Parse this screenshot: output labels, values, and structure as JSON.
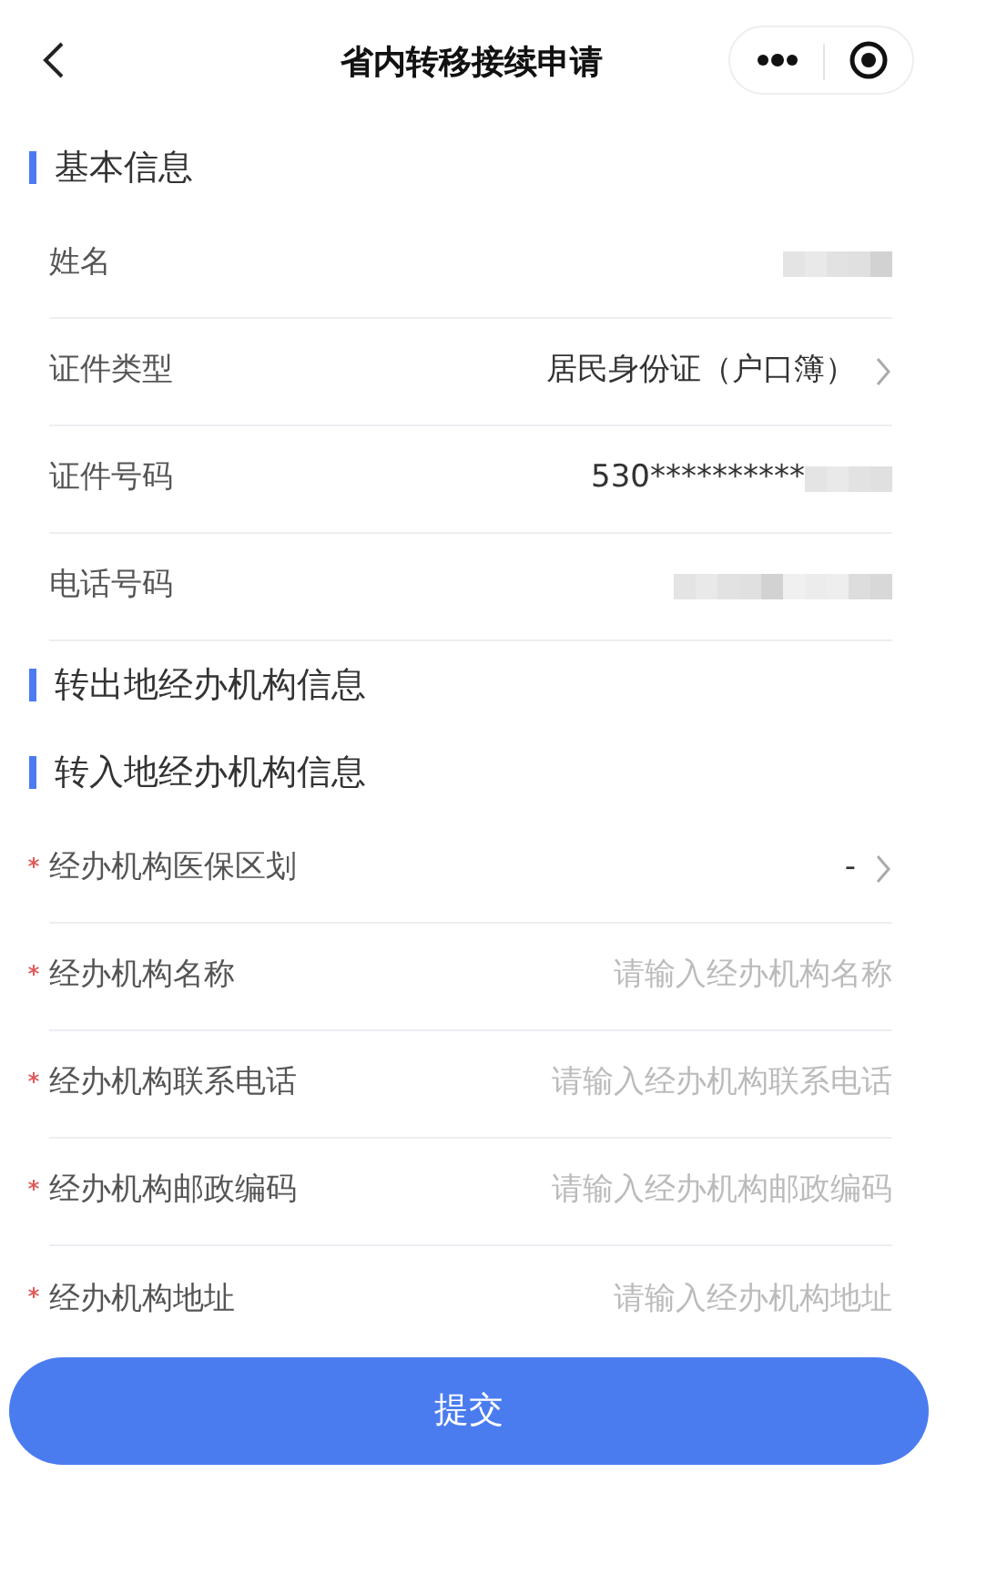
{
  "header": {
    "title": "省内转移接续申请"
  },
  "sections": [
    {
      "title": "基本信息",
      "rows": [
        {
          "kind": "redacted",
          "label": "姓名",
          "required": false
        },
        {
          "kind": "select",
          "label": "证件类型",
          "value": "居民身份证（户口簿）",
          "required": false
        },
        {
          "kind": "partial",
          "label": "证件号码",
          "value": "530**********",
          "required": false
        },
        {
          "kind": "redacted",
          "label": "电话号码",
          "required": false
        }
      ]
    },
    {
      "title": "转出地经办机构信息"
    },
    {
      "title": "转入地经办机构信息",
      "rows": [
        {
          "kind": "select",
          "label": "经办机构医保区划",
          "value": "-",
          "required": true
        },
        {
          "kind": "input",
          "label": "经办机构名称",
          "placeholder": "请输入经办机构名称",
          "required": true
        },
        {
          "kind": "input",
          "label": "经办机构联系电话",
          "placeholder": "请输入经办机构联系电话",
          "required": true
        },
        {
          "kind": "input",
          "label": "经办机构邮政编码",
          "placeholder": "请输入经办机构邮政编码",
          "required": true
        },
        {
          "kind": "input",
          "label": "经办机构地址",
          "placeholder": "请输入经办机构地址",
          "required": true
        }
      ]
    }
  ],
  "submit": {
    "label": "提交"
  }
}
